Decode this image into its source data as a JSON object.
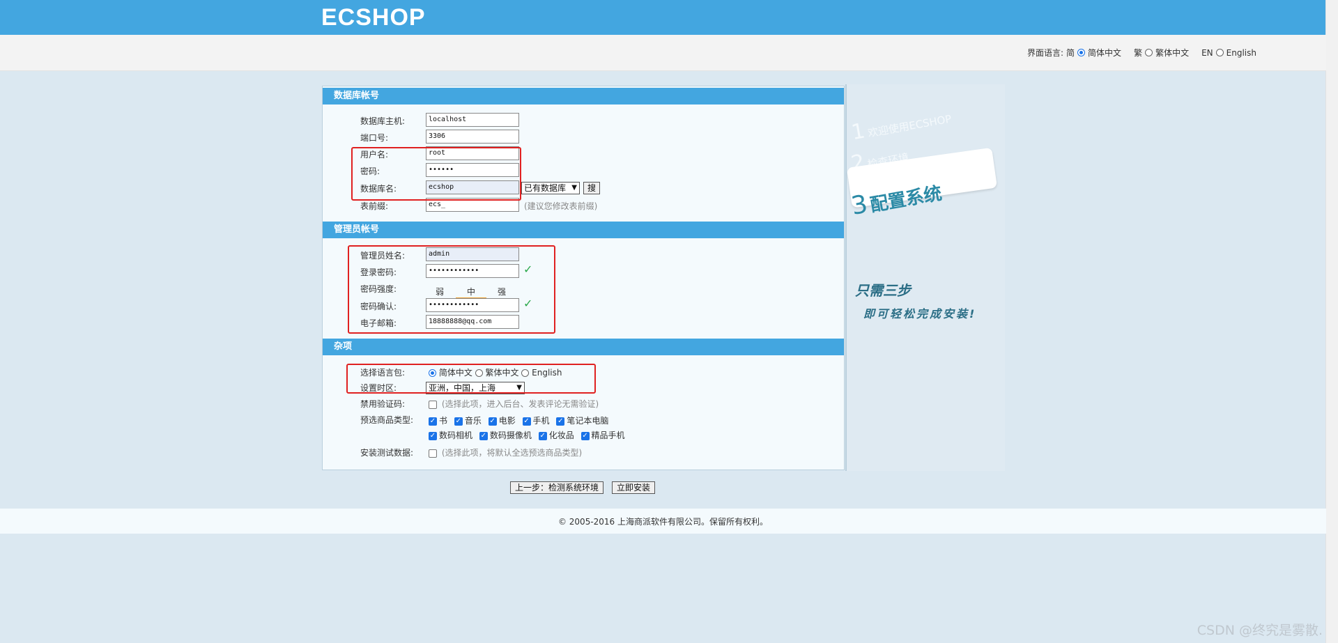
{
  "header": {
    "logo": "ECSHOP"
  },
  "language_bar": {
    "label": "界面语言:",
    "opt1_prefix": "简",
    "opt1": "简体中文",
    "opt2_prefix": "繁",
    "opt2": "繁体中文",
    "opt3_prefix": "EN",
    "opt3": "English",
    "selected": "简体中文"
  },
  "db": {
    "title": "数据库帐号",
    "host_label": "数据库主机:",
    "host": "localhost",
    "port_label": "端口号:",
    "port": "3306",
    "user_label": "用户名:",
    "user": "root",
    "pass_label": "密码:",
    "pass": "••••••",
    "name_label": "数据库名:",
    "name": "ecshop",
    "existing_db": "已有数据库",
    "search_btn": "搜",
    "prefix_label": "表前缀:",
    "prefix": "ecs_",
    "prefix_hint": "(建议您修改表前缀)"
  },
  "admin": {
    "title": "管理员帐号",
    "name_label": "管理员姓名:",
    "name": "admin",
    "pass_label": "登录密码:",
    "pass": "••••••••••••",
    "strength_label": "密码强度:",
    "weak": "弱",
    "medium": "中",
    "strong": "强",
    "confirm_label": "密码确认:",
    "confirm": "••••••••••••",
    "email_label": "电子邮箱:",
    "email": "18888888@qq.com"
  },
  "misc": {
    "title": "杂项",
    "lang_label": "选择语言包:",
    "lang1": "简体中文",
    "lang2": "繁体中文",
    "lang3": "English",
    "tz_label": "设置时区:",
    "tz": "亚洲，中国，上海",
    "captcha_label": "禁用验证码:",
    "captcha_hint": "(选择此项，进入后台、发表评论无需验证)",
    "goods_label": "预选商品类型:",
    "goods": [
      "书",
      "音乐",
      "电影",
      "手机",
      "笔记本电脑",
      "数码相机",
      "数码摄像机",
      "化妆品",
      "精品手机"
    ],
    "testdata_label": "安装测试数据:",
    "testdata_hint": "(选择此项，将默认全选预选商品类型)"
  },
  "buttons": {
    "prev": "上一步：检测系统环境",
    "install": "立即安装"
  },
  "steps": {
    "s1_num": "1",
    "s1": "欢迎使用ECSHOP",
    "s2_num": "2",
    "s2": "检查环境",
    "s3_num": "3",
    "s3": "配置系统",
    "slogan1": "只需三步",
    "slogan2": "即可轻松完成安装!"
  },
  "footer": {
    "copyright": "© 2005-2016 上海商派软件有限公司。保留所有权利。"
  },
  "watermark": "CSDN @终究是雾散."
}
